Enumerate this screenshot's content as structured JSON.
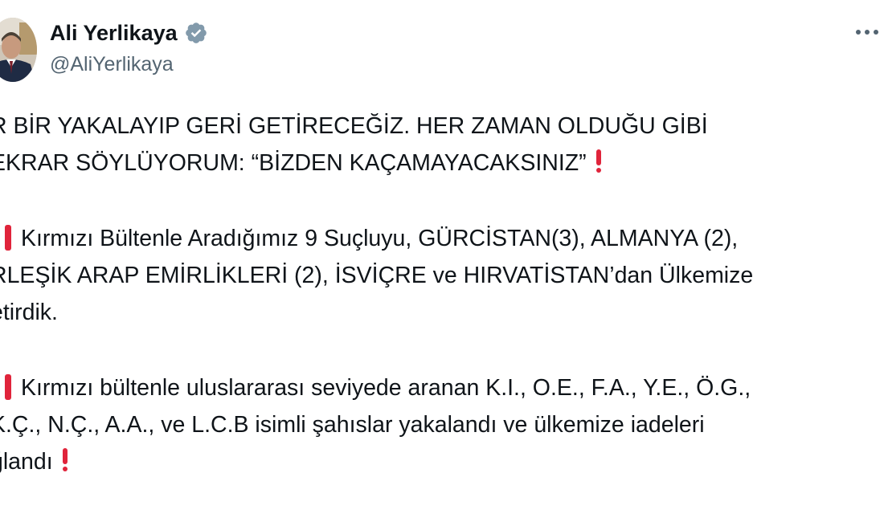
{
  "author": {
    "display_name": "Ali Yerlikaya",
    "handle": "@AliYerlikaya",
    "verified": true,
    "verified_color": "#829aab"
  },
  "menu": {
    "more_icon": "more-horizontal-icon"
  },
  "tweet": {
    "lines": [
      "R BİR YAKALAYIP GERİ GETİRECEĞİZ. HER ZAMAN OLDUĞU GİBİ",
      "EKRAR SÖYLÜYORUM: “BİZDEN KAÇAMAYACAKSINIZ”",
      "Kırmızı Bültenle Aradığımız 9 Suçluyu, GÜRCİSTAN(3), ALMANYA (2),",
      "RLEŞİK ARAP EMİRLİKLERİ (2), İSVİÇRE ve HIRVATİSTAN’dan  Ülkemize",
      "etirdik.",
      "Kırmızı bültenle uluslararası seviyede aranan K.I., O.E., F.A., Y.E., Ö.G.,",
      "K.Ç., N.Ç., A.A., ve L.C.B isimli şahıslar yakalandı ve ülkemize iadeleri",
      "ğlandı"
    ],
    "emoji_color": "#e0243b"
  }
}
